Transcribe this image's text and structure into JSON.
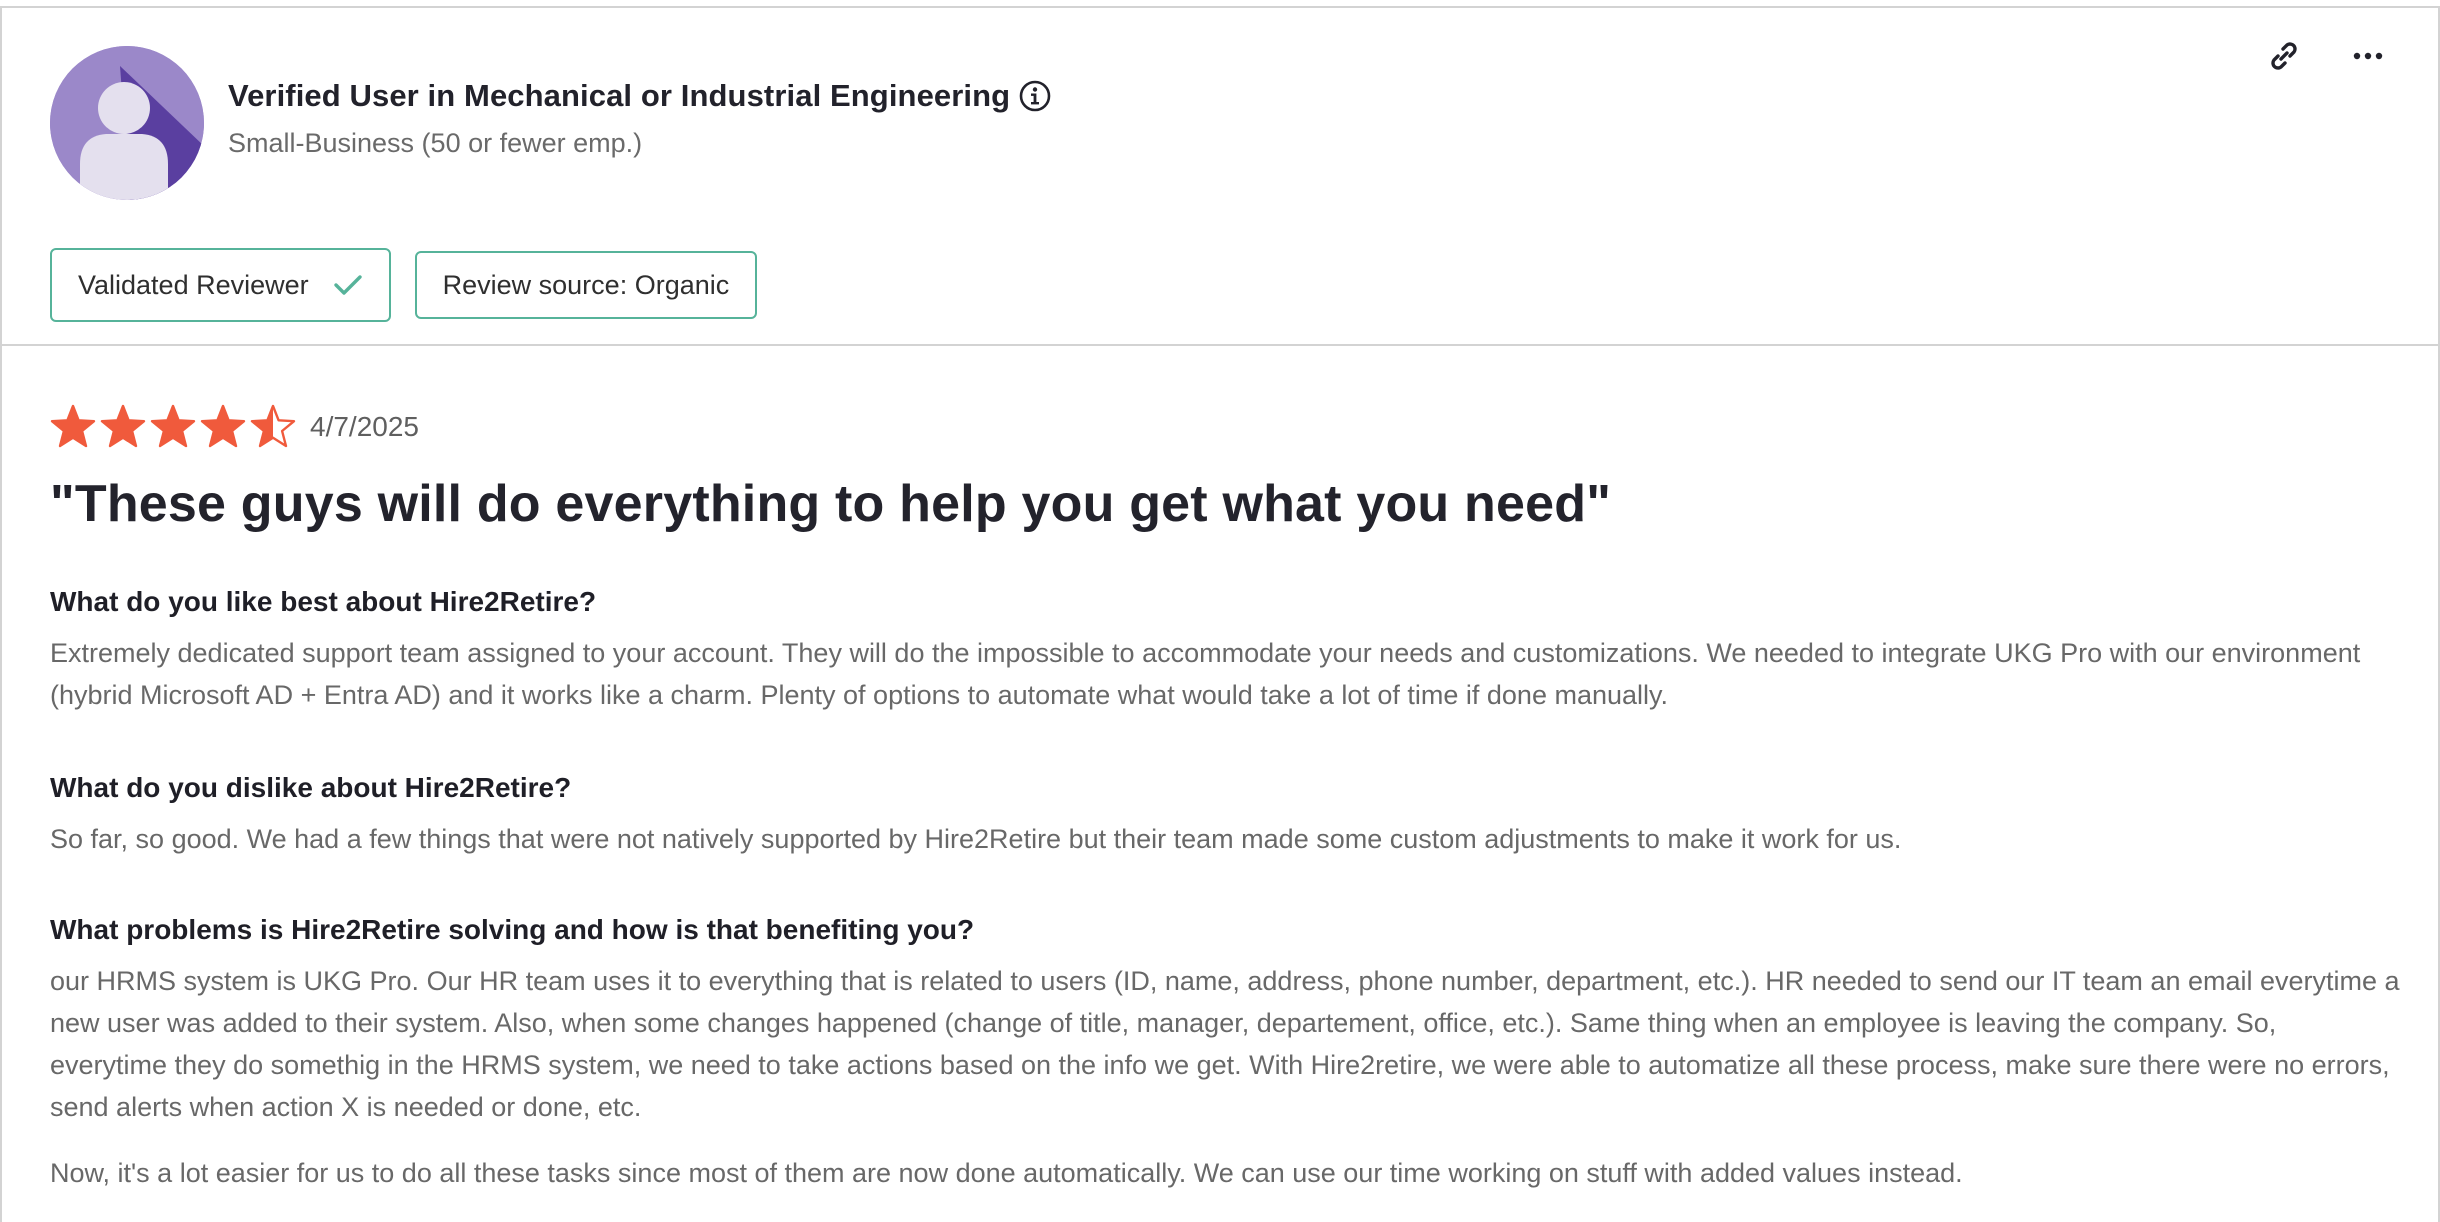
{
  "reviewer": {
    "title": "Verified User in Mechanical or Industrial Engineering",
    "subtitle": "Small-Business (50 or fewer emp.)"
  },
  "badges": {
    "validated": "Validated Reviewer",
    "source": "Review source: Organic"
  },
  "review": {
    "rating": 4.5,
    "max_rating": 5,
    "date": "4/7/2025",
    "title": "\"These guys will do everything to help you get what you need\"",
    "sections": [
      {
        "question": "What do you like best about Hire2Retire?",
        "answers": [
          "Extremely dedicated support team assigned to your account. They will do the impossible to accommodate your needs and customizations. We needed to integrate UKG Pro with our environment (hybrid Microsoft AD + Entra AD) and it works like a charm. Plenty of options to automate what would take a lot of time if done manually."
        ]
      },
      {
        "question": "What do you dislike about Hire2Retire?",
        "answers": [
          "So far, so good. We had a few things that were not natively supported by Hire2Retire but their team made some custom adjustments to make it work for us."
        ]
      },
      {
        "question": "What problems is Hire2Retire solving and how is that benefiting you?",
        "answers": [
          "our HRMS system is UKG Pro. Our HR team uses it to everything that is related to users (ID, name, address, phone number, department, etc.). HR needed to send our IT team an email everytime a new user was added to their system. Also, when some changes happened (change of title, manager, departement, office, etc.). Same thing when an employee is leaving the company. So, everytime they do somethig in the HRMS system, we need to take actions based on the info we get. With Hire2retire, we were able to automatize all these process, make sure there were no errors, send alerts when action X is needed or done, etc.",
          "Now, it's a lot easier for us to do all these tasks since most of them are now done automatically. We can use our time working on stuff with added values instead."
        ]
      }
    ]
  },
  "colors": {
    "star": "#f05a3c",
    "badge_border": "#56b39a",
    "avatar_bg": "#9b88c9",
    "avatar_shadow": "#5a3fa0"
  },
  "icons": {
    "link": "link-icon",
    "more": "more-horizontal-icon",
    "info": "info-icon",
    "check": "check-icon"
  }
}
